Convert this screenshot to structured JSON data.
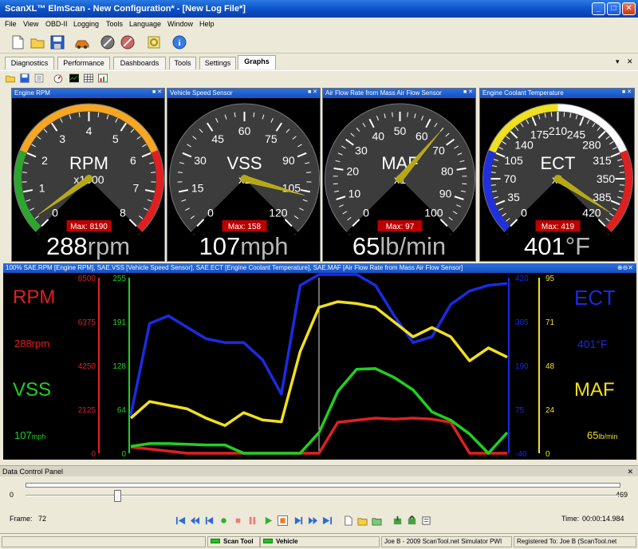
{
  "window": {
    "title": "ScanXL™ ElmScan - New Configuration* - [New Log File*]"
  },
  "menu": [
    "File",
    "View",
    "OBD-II",
    "Logging",
    "Tools",
    "Language",
    "Window",
    "Help"
  ],
  "tabs": [
    {
      "label": "Diagnostics",
      "active": false
    },
    {
      "label": "Performance",
      "active": false
    },
    {
      "label": "Dashboards",
      "active": false
    },
    {
      "label": "Tools",
      "active": false
    },
    {
      "label": "Settings",
      "active": false
    },
    {
      "label": "Graphs",
      "active": true
    }
  ],
  "gauges": [
    {
      "title": "Engine RPM",
      "name": "RPM",
      "mult": "x1000",
      "ticks": [
        "0",
        "1",
        "2",
        "3",
        "4",
        "5",
        "6",
        "7",
        "8"
      ],
      "max_label": "Max: 8190",
      "value_num": "288",
      "value_unit": "rpm",
      "needle_fraction": 0.036,
      "bands": [
        {
          "from": 0,
          "to": 0.25,
          "color": "#2ea52e"
        },
        {
          "from": 0.25,
          "to": 0.75,
          "color": "#f5a623"
        },
        {
          "from": 0.75,
          "to": 1,
          "color": "#e02020"
        }
      ]
    },
    {
      "title": "Vehicle Speed Sensor",
      "name": "VSS",
      "mult": "x1",
      "ticks": [
        "0",
        "15",
        "30",
        "45",
        "60",
        "75",
        "90",
        "105",
        "120"
      ],
      "max_label": "Max: 158",
      "value_num": "107",
      "value_unit": "mph",
      "needle_fraction": 0.89,
      "bands": []
    },
    {
      "title": "Air Flow Rate from Mass Air Flow Sensor",
      "name": "MAF",
      "mult": "x1",
      "ticks": [
        "0",
        "10",
        "20",
        "30",
        "40",
        "50",
        "60",
        "70",
        "80",
        "90",
        "100"
      ],
      "max_label": "Max: 97",
      "value_num": "65",
      "value_unit": "lb/min",
      "needle_fraction": 0.65,
      "bands": []
    },
    {
      "title": "Engine Coolant Temperature",
      "name": "ECT",
      "mult": "x1",
      "ticks": [
        "0",
        "35",
        "70",
        "105",
        "140",
        "175",
        "210",
        "245",
        "280",
        "315",
        "350",
        "385",
        "420"
      ],
      "max_label": "Max: 419",
      "value_num": "401",
      "value_unit": "°F",
      "needle_fraction": 0.955,
      "bands": [
        {
          "from": 0,
          "to": 0.25,
          "color": "#2030e0"
        },
        {
          "from": 0.25,
          "to": 0.5,
          "color": "#f0e020"
        },
        {
          "from": 0.5,
          "to": 0.75,
          "color": "#ffffff"
        },
        {
          "from": 0.75,
          "to": 1,
          "color": "#e02020"
        }
      ]
    }
  ],
  "graph": {
    "title": "100% SAE.RPM [Engine RPM], SAE.VSS [Vehicle Speed Sensor], SAE.ECT [Engine Coolant Temperature], SAE.MAF [Air Flow Rate from Mass Air Flow Sensor]",
    "left_labels": {
      "rpm_name": "RPM",
      "rpm_value": "288rpm",
      "vss_name": "VSS",
      "vss_value": "107",
      "vss_unit": "mph"
    },
    "right_labels": {
      "ect_name": "ECT",
      "ect_value": "401°F",
      "maf_name": "MAF",
      "maf_value": "65",
      "maf_unit": "lb/min"
    },
    "rpm_axis": [
      "8500",
      "6375",
      "4250",
      "2125",
      "0"
    ],
    "vss_axis": [
      "255",
      "191",
      "128",
      "64",
      "0"
    ],
    "ect_axis": [
      "420",
      "305",
      "190",
      "75",
      "-40"
    ],
    "maf_axis": [
      "95",
      "71",
      "48",
      "24",
      "0"
    ]
  },
  "chart_data": {
    "type": "line",
    "x": [
      0,
      5,
      10,
      15,
      20,
      25,
      30,
      35,
      40,
      45,
      50,
      55,
      60,
      65,
      70,
      75,
      80,
      85,
      90,
      95,
      100
    ],
    "series": [
      {
        "name": "RPM",
        "color": "#e02020",
        "values": [
          300,
          200,
          100,
          0,
          0,
          0,
          0,
          0,
          0,
          0,
          0,
          1500,
          1600,
          1700,
          1650,
          1700,
          1650,
          1500,
          0,
          0,
          0
        ]
      },
      {
        "name": "VSS",
        "color": "#20d020",
        "values": [
          10,
          14,
          14,
          13,
          12,
          12,
          0,
          0,
          0,
          0,
          30,
          90,
          122,
          123,
          110,
          92,
          60,
          48,
          28,
          0,
          30
        ]
      },
      {
        "name": "ECT",
        "color": "#1a2be0",
        "values": [
          60,
          300,
          320,
          290,
          260,
          250,
          250,
          205,
          115,
          400,
          470,
          460,
          450,
          400,
          320,
          250,
          265,
          350,
          385,
          400,
          405
        ]
      },
      {
        "name": "MAF",
        "color": "#f0e020",
        "values": [
          19,
          28,
          26,
          24,
          19,
          15,
          22,
          18,
          17,
          55,
          79,
          82,
          81,
          79,
          71,
          63,
          68,
          63,
          50,
          57,
          52
        ]
      }
    ]
  },
  "dcp": {
    "title": "Data Control Panel",
    "min": "0",
    "max": "469",
    "frame_label": "Frame:",
    "frame_value": "72",
    "time_label": "Time:",
    "time_value": "00:00:14.984",
    "slider_fraction": 0.154
  },
  "status": {
    "scan_tool": "Scan Tool",
    "vehicle": "Vehicle",
    "copyright": "Joe B - 2009 ScanTool.net Simulator PWI",
    "registered": "Registered To: Joe B (ScanTool.net"
  }
}
